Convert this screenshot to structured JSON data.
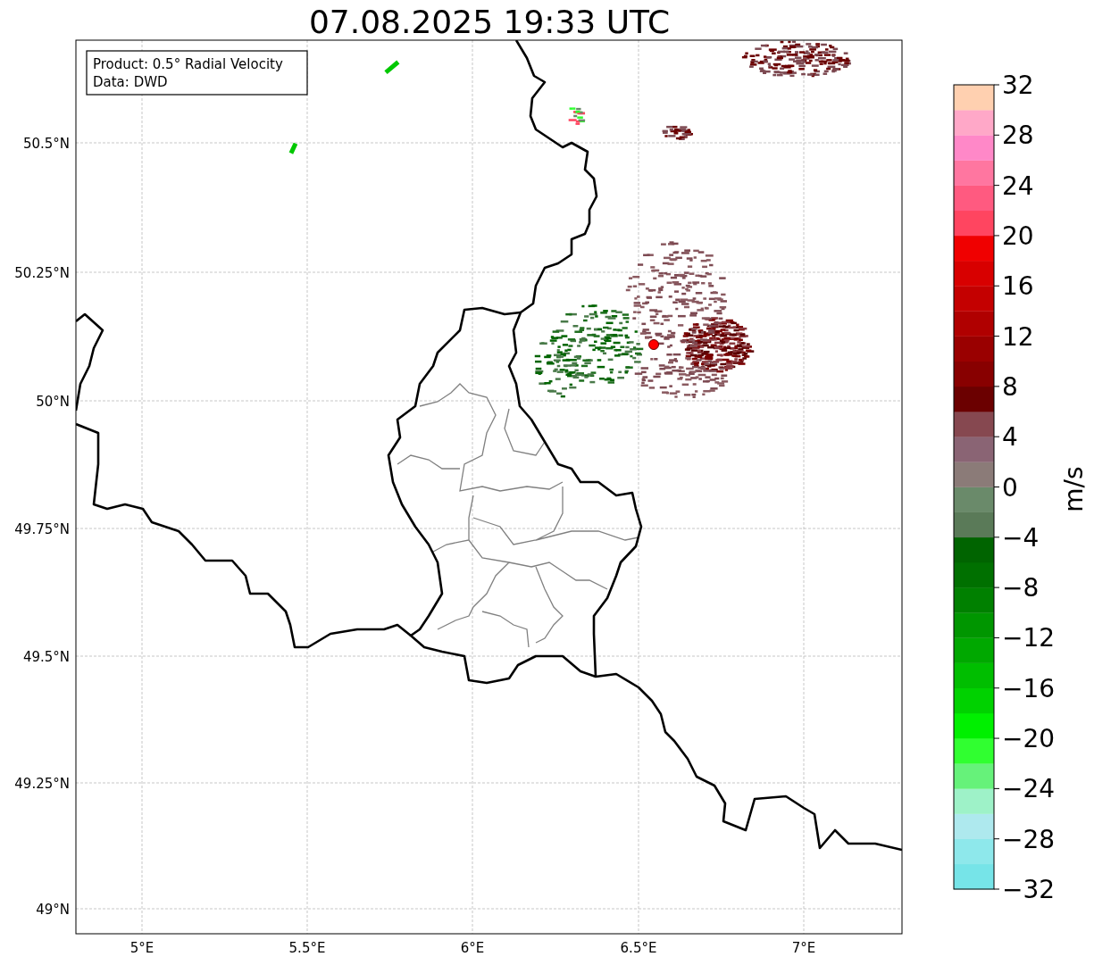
{
  "title": "07.08.2025 19:33 UTC",
  "info_box": [
    "Product: 0.5° Radial Velocity",
    "Data: DWD"
  ],
  "map": {
    "lat_labels": [
      "50.5°N",
      "50.25°N",
      "50°N",
      "49.75°N",
      "49.5°N",
      "49.25°N",
      "49°N"
    ],
    "lon_labels": [
      "5°E",
      "5.5°E",
      "6°E",
      "6.5°E",
      "7°E"
    ]
  },
  "colorbar": {
    "label": "m/s",
    "ticks": [
      "32",
      "28",
      "24",
      "20",
      "16",
      "12",
      "8",
      "4",
      "0",
      "−4",
      "−8",
      "−12",
      "−16",
      "−20",
      "−24",
      "−28",
      "−32"
    ],
    "bands": [
      {
        "color": "#76e4e8"
      },
      {
        "color": "#8ee8eb"
      },
      {
        "color": "#aee9ee"
      },
      {
        "color": "#9ef2c8"
      },
      {
        "color": "#66f27a"
      },
      {
        "color": "#30ff30"
      },
      {
        "color": "#00f000"
      },
      {
        "color": "#00d200"
      },
      {
        "color": "#00be00"
      },
      {
        "color": "#00a800"
      },
      {
        "color": "#009600"
      },
      {
        "color": "#008000"
      },
      {
        "color": "#007000"
      },
      {
        "color": "#006400"
      },
      {
        "color": "#5a7a58"
      },
      {
        "color": "#6a8a6a"
      },
      {
        "color": "#8b7b78"
      },
      {
        "color": "#8a6474"
      },
      {
        "color": "#864850"
      },
      {
        "color": "#6b0000"
      },
      {
        "color": "#880000"
      },
      {
        "color": "#9a0000"
      },
      {
        "color": "#b00000"
      },
      {
        "color": "#c40000"
      },
      {
        "color": "#d80000"
      },
      {
        "color": "#f00000"
      },
      {
        "color": "#ff4560"
      },
      {
        "color": "#ff5a80"
      },
      {
        "color": "#ff76a0"
      },
      {
        "color": "#ff88c8"
      },
      {
        "color": "#ffa8c8"
      },
      {
        "color": "#ffd0b0"
      }
    ]
  }
}
